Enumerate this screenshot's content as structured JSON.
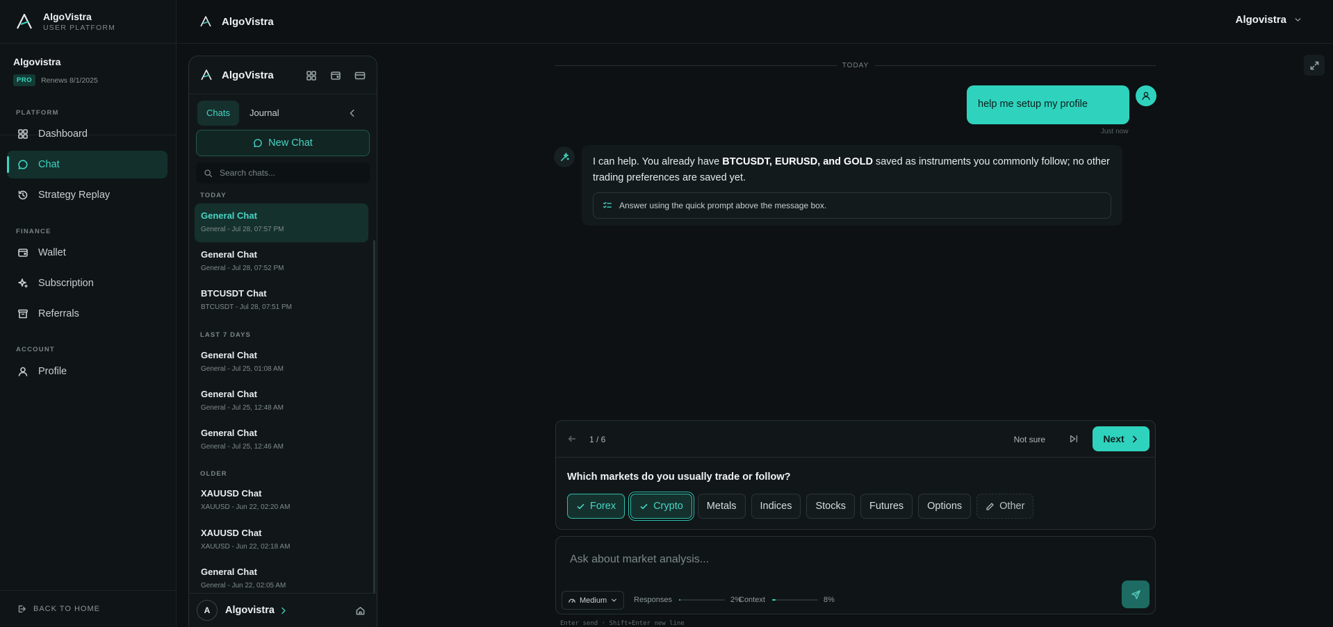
{
  "brand": {
    "name": "AlgoVistra",
    "tagline": "USER PLATFORM"
  },
  "user": {
    "name": "Algovistra",
    "plan": "PRO",
    "renews": "Renews 8/1/2025"
  },
  "nav": {
    "sections": [
      {
        "label": "PLATFORM",
        "items": [
          "Dashboard",
          "Chat",
          "Strategy Replay"
        ]
      },
      {
        "label": "FINANCE",
        "items": [
          "Wallet",
          "Subscription",
          "Referrals"
        ]
      },
      {
        "label": "ACCOUNT",
        "items": [
          "Profile"
        ]
      }
    ],
    "active": "Chat",
    "back_label": "BACK TO HOME"
  },
  "topbar": {
    "title": "AlgoVistra",
    "account": "Algovistra"
  },
  "panel": {
    "title": "AlgoVistra",
    "tabs": [
      "Chats",
      "Journal"
    ],
    "active_tab": "Chats",
    "new_chat": "New Chat",
    "search_placeholder": "Search chats...",
    "groups": [
      {
        "label": "TODAY",
        "chats": [
          {
            "title": "General Chat",
            "meta": "General - Jul 28, 07:57 PM",
            "active": true
          },
          {
            "title": "General Chat",
            "meta": "General - Jul 28, 07:52 PM"
          },
          {
            "title": "BTCUSDT Chat",
            "meta": "BTCUSDT - Jul 28, 07:51 PM"
          }
        ]
      },
      {
        "label": "LAST 7 DAYS",
        "chats": [
          {
            "title": "General Chat",
            "meta": "General - Jul 25, 01:08 AM"
          },
          {
            "title": "General Chat",
            "meta": "General - Jul 25, 12:48 AM"
          },
          {
            "title": "General Chat",
            "meta": "General - Jul 25, 12:46 AM"
          }
        ]
      },
      {
        "label": "OLDER",
        "chats": [
          {
            "title": "XAUUSD Chat",
            "meta": "XAUUSD - Jun 22, 02:20 AM"
          },
          {
            "title": "XAUUSD Chat",
            "meta": "XAUUSD - Jun 22, 02:18 AM"
          },
          {
            "title": "General Chat",
            "meta": "General - Jun 22, 02:05 AM"
          }
        ]
      }
    ],
    "footer": {
      "avatar": "A",
      "name": "Algovistra"
    }
  },
  "conversation": {
    "day_label": "TODAY",
    "user_message": "help me setup my profile",
    "user_time": "Just now",
    "assistant": {
      "before": "I can help. You already have ",
      "bold": "BTCUSDT, EURUSD, and GOLD",
      "after": " saved as instruments you commonly follow; no other trading preferences are saved yet.",
      "hint": "Answer using the quick prompt above the message box."
    }
  },
  "question": {
    "progress": "1 / 6",
    "not_sure": "Not sure",
    "next": "Next",
    "text": "Which markets do you usually trade or follow?",
    "options": [
      {
        "label": "Forex",
        "selected": true
      },
      {
        "label": "Crypto",
        "selected": true
      },
      {
        "label": "Metals",
        "selected": false
      },
      {
        "label": "Indices",
        "selected": false
      },
      {
        "label": "Stocks",
        "selected": false
      },
      {
        "label": "Futures",
        "selected": false
      },
      {
        "label": "Options",
        "selected": false
      },
      {
        "label": "Other",
        "selected": false
      }
    ]
  },
  "composer": {
    "placeholder": "Ask about market analysis...",
    "model": "Medium",
    "responses_label": "Responses",
    "responses_pct": "2%",
    "responses_value": 0.02,
    "context_label": "Context",
    "context_pct": "8%",
    "context_value": 0.08,
    "shortcut_hint": "Enter send · Shift+Enter new line"
  },
  "colors": {
    "accent": "#2fd3bd",
    "background": "#0d1113",
    "panel": "#111719"
  }
}
